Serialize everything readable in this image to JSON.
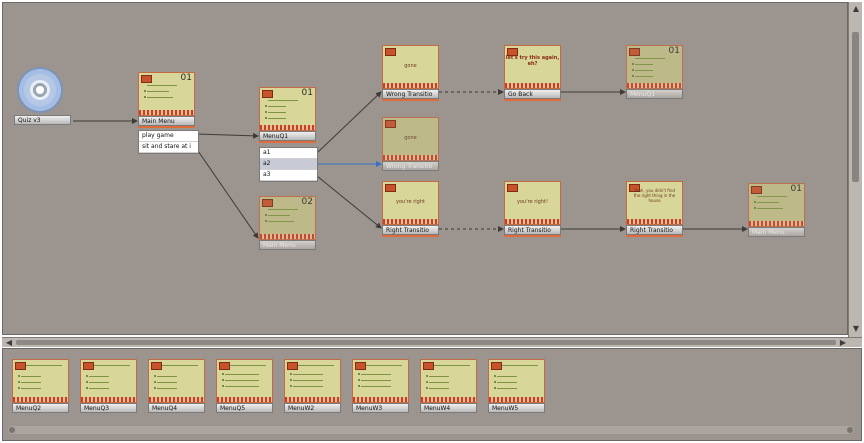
{
  "start": {
    "caption": "Quiz v3"
  },
  "nodes": [
    {
      "id": "main_menu",
      "caption": "Main Menu",
      "number": "01"
    },
    {
      "id": "menuq1",
      "caption": "MenuQ1",
      "number": "01"
    },
    {
      "id": "main_menu_2",
      "caption": "Main Menu",
      "number": "02"
    },
    {
      "id": "wrong_transition",
      "caption": "Wrong Transitio",
      "text": "gone"
    },
    {
      "id": "wrong_transition_2",
      "caption": "Wrong Transitio",
      "text": "gone"
    },
    {
      "id": "go_back",
      "caption": "Go Back",
      "text": "let's try this again, eh?"
    },
    {
      "id": "menuq1_ghost",
      "caption": "MenuQ1",
      "number": "01"
    },
    {
      "id": "right_transition_1",
      "caption": "Right Transitio",
      "text": "you're right"
    },
    {
      "id": "right_transition_2",
      "caption": "Right Transitio",
      "text": "you're right!"
    },
    {
      "id": "right_transition_3",
      "caption": "Right Transitio",
      "text": "Yeah, you didn't find the right thing in the house"
    },
    {
      "id": "main_menu_ghost",
      "caption": "Main Menu",
      "number": "01"
    }
  ],
  "main_menu_choices": [
    "play game",
    "sit and stare at i"
  ],
  "menuq1_choices": [
    "a1",
    "a2",
    "a3"
  ],
  "tray": [
    "MenuQ2",
    "MenuQ3",
    "MenuQ4",
    "MenuQ5",
    "MenuW2",
    "MenuW3",
    "MenuW4",
    "MenuW5"
  ],
  "colors": {
    "canvas": "#9b948f",
    "connector": "#3e3a37",
    "selected_connector": "#3b6fc4",
    "thumb_bg": "#d9d69a",
    "thumb_border": "#c56b43"
  }
}
